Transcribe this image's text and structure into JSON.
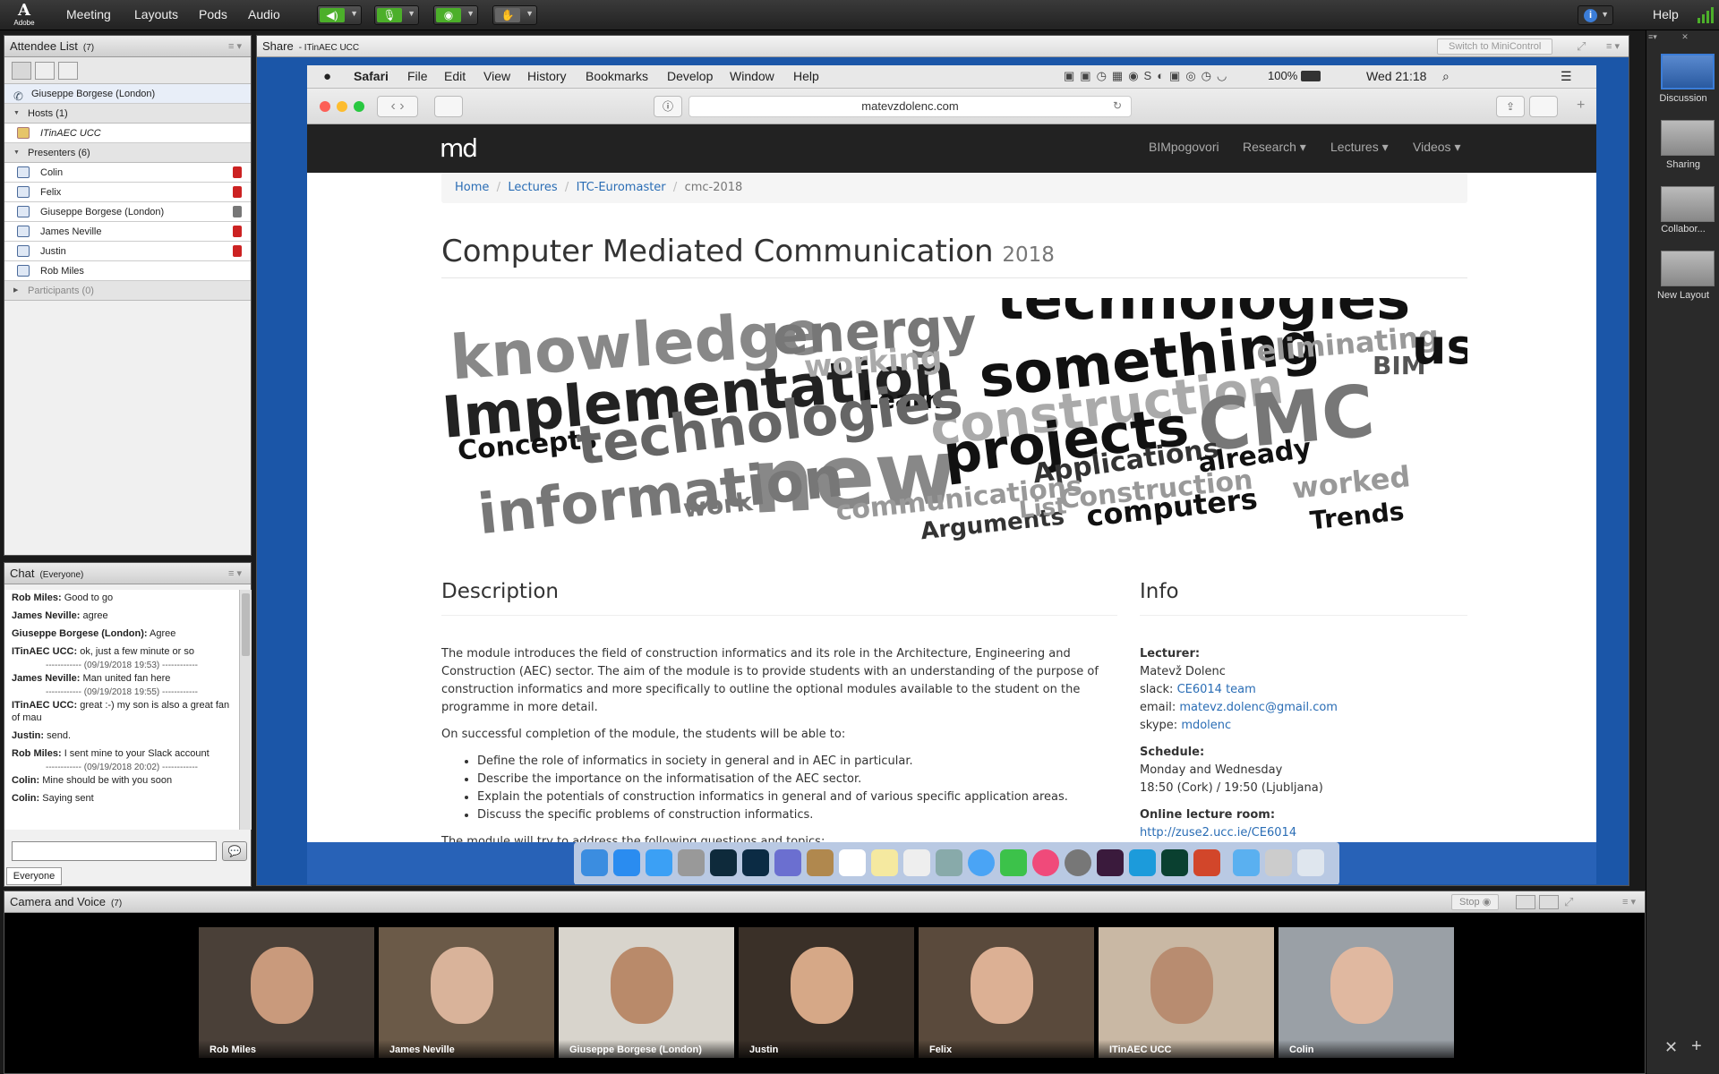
{
  "topbar": {
    "logo_text": "Adobe",
    "menus": [
      "Meeting",
      "Layouts",
      "Pods",
      "Audio"
    ],
    "help": "Help"
  },
  "attendee": {
    "title": "Attendee List",
    "count": "(7)",
    "current_user": "Giuseppe Borgese (London)",
    "hosts_label": "Hosts (1)",
    "hosts": [
      "ITinAEC UCC"
    ],
    "presenters_label": "Presenters (6)",
    "presenters": [
      "Colin",
      "Felix",
      "Giuseppe Borgese (London)",
      "James Neville",
      "Justin",
      "Rob Miles"
    ],
    "participants_label": "Participants (0)"
  },
  "chat": {
    "title": "Chat",
    "scope": "(Everyone)",
    "messages": [
      {
        "name": "Rob Miles:",
        "text": "Good to go"
      },
      {
        "name": "James Neville:",
        "text": "agree"
      },
      {
        "name": "Giuseppe Borgese (London):",
        "text": "Agree"
      },
      {
        "name": "ITinAEC UCC:",
        "text": "ok, just a few minute or so"
      },
      {
        "ts": "------------ (09/19/2018 19:53) ------------"
      },
      {
        "name": "James Neville:",
        "text": "Man united fan here"
      },
      {
        "ts": "------------ (09/19/2018 19:55) ------------"
      },
      {
        "name": "ITinAEC UCC:",
        "text": "great :-) my son is also a great fan of mau"
      },
      {
        "name": "Justin:",
        "text": "send."
      },
      {
        "name": "Rob Miles:",
        "text": "I sent mine to your Slack account"
      },
      {
        "ts": "------------ (09/19/2018 20:02) ------------"
      },
      {
        "name": "Colin:",
        "text": "Mine should be with you soon"
      },
      {
        "name": "Colin:",
        "text": "Saying sent"
      }
    ],
    "tab": "Everyone"
  },
  "share": {
    "title": "Share",
    "presenter": "- ITinAEC UCC",
    "mini_button": "Switch to MiniControl"
  },
  "macbar": {
    "app": "Safari",
    "menus": [
      "File",
      "Edit",
      "View",
      "History",
      "Bookmarks",
      "Develop",
      "Window",
      "Help"
    ],
    "battery": "100%",
    "clock": "Wed 21:18"
  },
  "safari": {
    "url": "matevzdolenc.com"
  },
  "site": {
    "logo": "md",
    "nav": [
      "BIMpogovori",
      "Research",
      "Lectures",
      "Videos"
    ],
    "breadcrumb": [
      "Home",
      "Lectures",
      "ITC-Euromaster",
      "cmc-2018"
    ],
    "title": "Computer Mediated Communication",
    "title_year": "2018",
    "cloud_words": [
      "knowledge",
      "energy",
      "technologies",
      "something",
      "eliminating",
      "BIM",
      "using",
      "Implementation",
      "working",
      "construction",
      "Learn",
      "CMC",
      "Concepts",
      "technologies",
      "new",
      "projects",
      "Applications",
      "already",
      "information",
      "work",
      "communications",
      "Arguments",
      "List",
      "Construction",
      "computers",
      "worked",
      "Trends"
    ],
    "desc_heading": "Description",
    "desc_p1": "The module introduces the field of construction informatics and its role in the Architecture, Engineering and Construction (AEC) sector. The aim of the module is to provide students with an understanding of the purpose of construction informatics and more specifically to outline the optional modules available to the student on the programme in more detail.",
    "desc_p2": "On successful completion of the module, the students will be able to:",
    "bullets": [
      "Define the role of informatics in society in general and in AEC in particular.",
      "Describe the importance on the informatisation of the AEC sector.",
      "Explain the potentials of construction informatics in general and of various specific application areas.",
      "Discuss the specific problems of construction informatics."
    ],
    "desc_p3": "The module will try to address the following questions and topics:",
    "info_heading": "Info",
    "lecturer_label": "Lecturer:",
    "lecturer": "Matevž Dolenc",
    "slack_label": "slack:",
    "slack": "CE6014 team",
    "email_label": "email:",
    "email": "matevz.dolenc@gmail.com",
    "skype_label": "skype:",
    "skype": "mdolenc",
    "schedule_label": "Schedule:",
    "schedule_days": "Monday and Wednesday",
    "schedule_time": "18:50 (Cork) / 19:50 (Ljubljana)",
    "room_label": "Online lecture room:",
    "room": "http://zuse2.ucc.ie/CE6014"
  },
  "camera": {
    "title": "Camera and Voice",
    "count": "(7)",
    "stop": "Stop",
    "tiles": [
      "Rob Miles",
      "James Neville",
      "Giuseppe Borgese (London)",
      "Justin",
      "Felix",
      "ITinAEC UCC",
      "Colin"
    ]
  },
  "layouts": [
    "Discussion",
    "Sharing",
    "Collabor...",
    "New Layout"
  ],
  "colors": {
    "accent": "#2a6db5",
    "mic_green": "#4caf2a",
    "mute_red": "#cc2222"
  }
}
